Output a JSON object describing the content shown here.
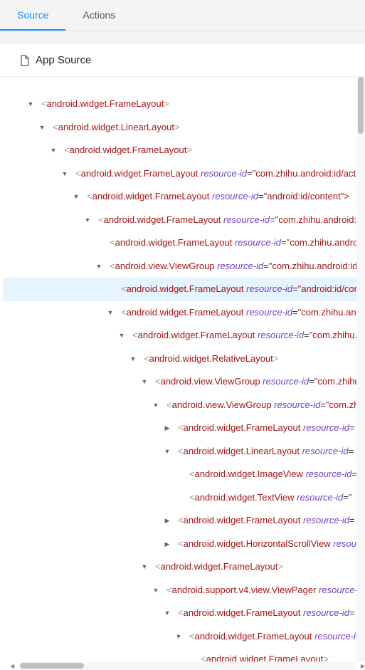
{
  "tabs": {
    "source": "Source",
    "actions": "Actions",
    "active": "source"
  },
  "panel": {
    "title": "App Source"
  },
  "tree": [
    {
      "depth": 0,
      "caret": "down",
      "tag": "android.widget.FrameLayout",
      "attrName": "",
      "attrVal": "",
      "selected": false
    },
    {
      "depth": 1,
      "caret": "down",
      "tag": "android.widget.LinearLayout",
      "attrName": "",
      "attrVal": "",
      "selected": false
    },
    {
      "depth": 2,
      "caret": "down",
      "tag": "android.widget.FrameLayout",
      "attrName": "",
      "attrVal": "",
      "selected": false
    },
    {
      "depth": 3,
      "caret": "down",
      "tag": "android.widget.FrameLayout",
      "attrName": "resource-id",
      "attrVal": "\"com.zhihu.android:id/action_b",
      "selected": false
    },
    {
      "depth": 4,
      "caret": "down",
      "tag": "android.widget.FrameLayout",
      "attrName": "resource-id",
      "attrVal": "\"android:id/content\">",
      "selected": false
    },
    {
      "depth": 5,
      "caret": "down",
      "tag": "android.widget.FrameLayout",
      "attrName": "resource-id",
      "attrVal": "\"com.zhihu.android:id/c",
      "selected": false
    },
    {
      "depth": 6,
      "caret": "none",
      "tag": "android.widget.FrameLayout",
      "attrName": "resource-id",
      "attrVal": "\"com.zhihu.android:i",
      "selected": false
    },
    {
      "depth": 6,
      "caret": "down",
      "tag": "android.view.ViewGroup",
      "attrName": "resource-id",
      "attrVal": "\"com.zhihu.android:id/co",
      "selected": false
    },
    {
      "depth": 7,
      "caret": "none",
      "tag": "android.widget.FrameLayout",
      "attrName": "resource-id",
      "attrVal": "\"android:id/conte",
      "selected": true
    },
    {
      "depth": 7,
      "caret": "down",
      "tag": "android.widget.FrameLayout",
      "attrName": "resource-id",
      "attrVal": "\"com.zhihu.andro",
      "selected": false
    },
    {
      "depth": 8,
      "caret": "down",
      "tag": "android.widget.FrameLayout",
      "attrName": "resource-id",
      "attrVal": "\"com.zhihu.an",
      "selected": false
    },
    {
      "depth": 9,
      "caret": "down",
      "tag": "android.widget.RelativeLayout",
      "attrName": "",
      "attrVal": "",
      "selected": false
    },
    {
      "depth": 10,
      "caret": "down",
      "tag": "android.view.ViewGroup",
      "attrName": "resource-id",
      "attrVal": "\"com.zhihu",
      "selected": false
    },
    {
      "depth": 11,
      "caret": "down",
      "tag": "android.view.ViewGroup",
      "attrName": "resource-id",
      "attrVal": "\"com.zh",
      "selected": false
    },
    {
      "depth": 12,
      "caret": "right",
      "tag": "android.widget.FrameLayout",
      "attrName": "resource-id",
      "attrVal": "",
      "selected": false
    },
    {
      "depth": 12,
      "caret": "down",
      "tag": "android.widget.LinearLayout",
      "attrName": "resource-id",
      "attrVal": "",
      "selected": false
    },
    {
      "depth": 13,
      "caret": "none",
      "tag": "android.widget.ImageView",
      "attrName": "resource-id",
      "attrVal": "",
      "selected": false
    },
    {
      "depth": 13,
      "caret": "none",
      "tag": "android.widget.TextView",
      "attrName": "resource-id",
      "attrVal": "\"",
      "selected": false
    },
    {
      "depth": 12,
      "caret": "right",
      "tag": "android.widget.FrameLayout",
      "attrName": "resource-id",
      "attrVal": "",
      "selected": false
    },
    {
      "depth": 12,
      "caret": "right",
      "tag": "android.widget.HorizontalScrollView",
      "attrName": "resou",
      "attrVal": "",
      "selected": false
    },
    {
      "depth": 10,
      "caret": "down",
      "tag": "android.widget.FrameLayout",
      "attrName": "",
      "attrVal": "",
      "selected": false
    },
    {
      "depth": 11,
      "caret": "down",
      "tag": "android.support.v4.view.ViewPager",
      "attrName": "resource-i",
      "attrVal": "",
      "selected": false
    },
    {
      "depth": 12,
      "caret": "down",
      "tag": "android.widget.FrameLayout",
      "attrName": "resource-id",
      "attrVal": "",
      "selected": false
    },
    {
      "depth": 13,
      "caret": "down",
      "tag": "android.widget.FrameLayout",
      "attrName": "resource-i",
      "attrVal": "",
      "selected": false
    },
    {
      "depth": 14,
      "caret": "none",
      "tag": "android.widget.FrameLayout",
      "attrName": "",
      "attrVal": "",
      "selected": false
    }
  ],
  "indentUnit": 16,
  "baseIndent": 34
}
